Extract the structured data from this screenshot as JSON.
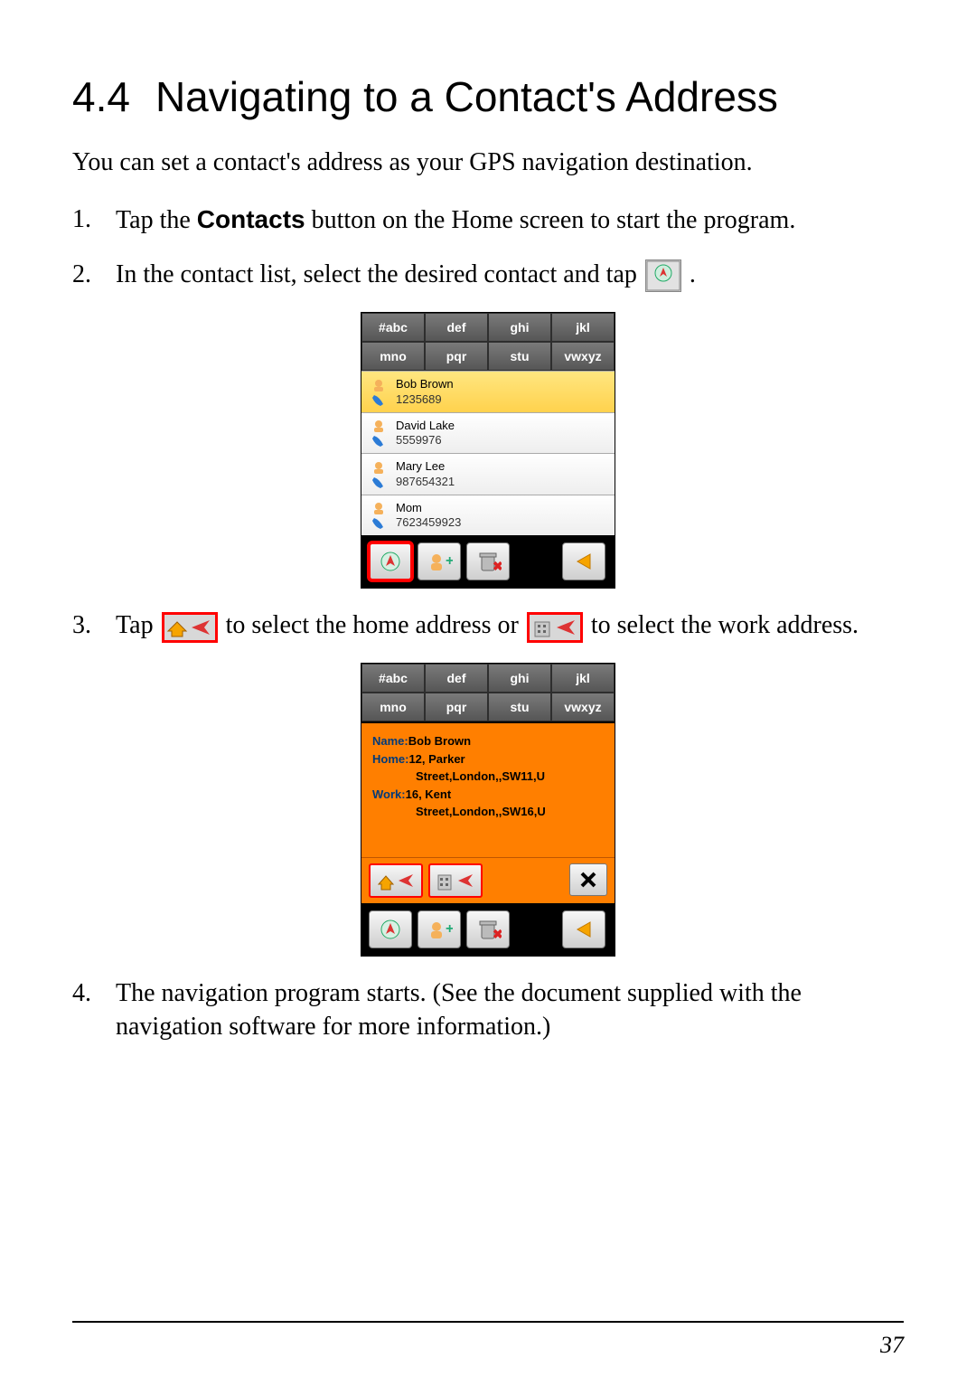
{
  "section_number": "4.4",
  "section_title": "Navigating to a Contact's Address",
  "intro": "You can set a contact's address as your GPS navigation destination.",
  "steps": {
    "s1_pre": "Tap the ",
    "s1_bold": "Contacts",
    "s1_post": " button on the Home screen to start the program.",
    "s2_pre": "In the contact list, select the desired contact and tap ",
    "s2_post": ".",
    "s3_pre": "Tap ",
    "s3_mid": " to select the home address or ",
    "s3_post": " to select the work address.",
    "s4": "The navigation program starts. (See the document supplied with the navigation software for more information.)"
  },
  "abc_tabs": [
    "#abc",
    "def",
    "ghi",
    "jkl",
    "mno",
    "pqr",
    "stu",
    "vwxyz"
  ],
  "contacts": [
    {
      "name": "Bob Brown",
      "number": "1235689",
      "selected": true
    },
    {
      "name": "David Lake",
      "number": "5559976",
      "selected": false
    },
    {
      "name": "Mary Lee",
      "number": "987654321",
      "selected": false
    },
    {
      "name": "Mom",
      "number": "7623459923",
      "selected": false
    }
  ],
  "detail": {
    "name_label": "Name:",
    "name_value": "Bob Brown",
    "home_label": "Home:",
    "home_value_l1": "12, Parker",
    "home_value_l2": "Street,London,,SW11,U",
    "work_label": "Work:",
    "work_value_l1": "16, Kent",
    "work_value_l2": "Street,London,,SW16,U"
  },
  "page_number": "37"
}
